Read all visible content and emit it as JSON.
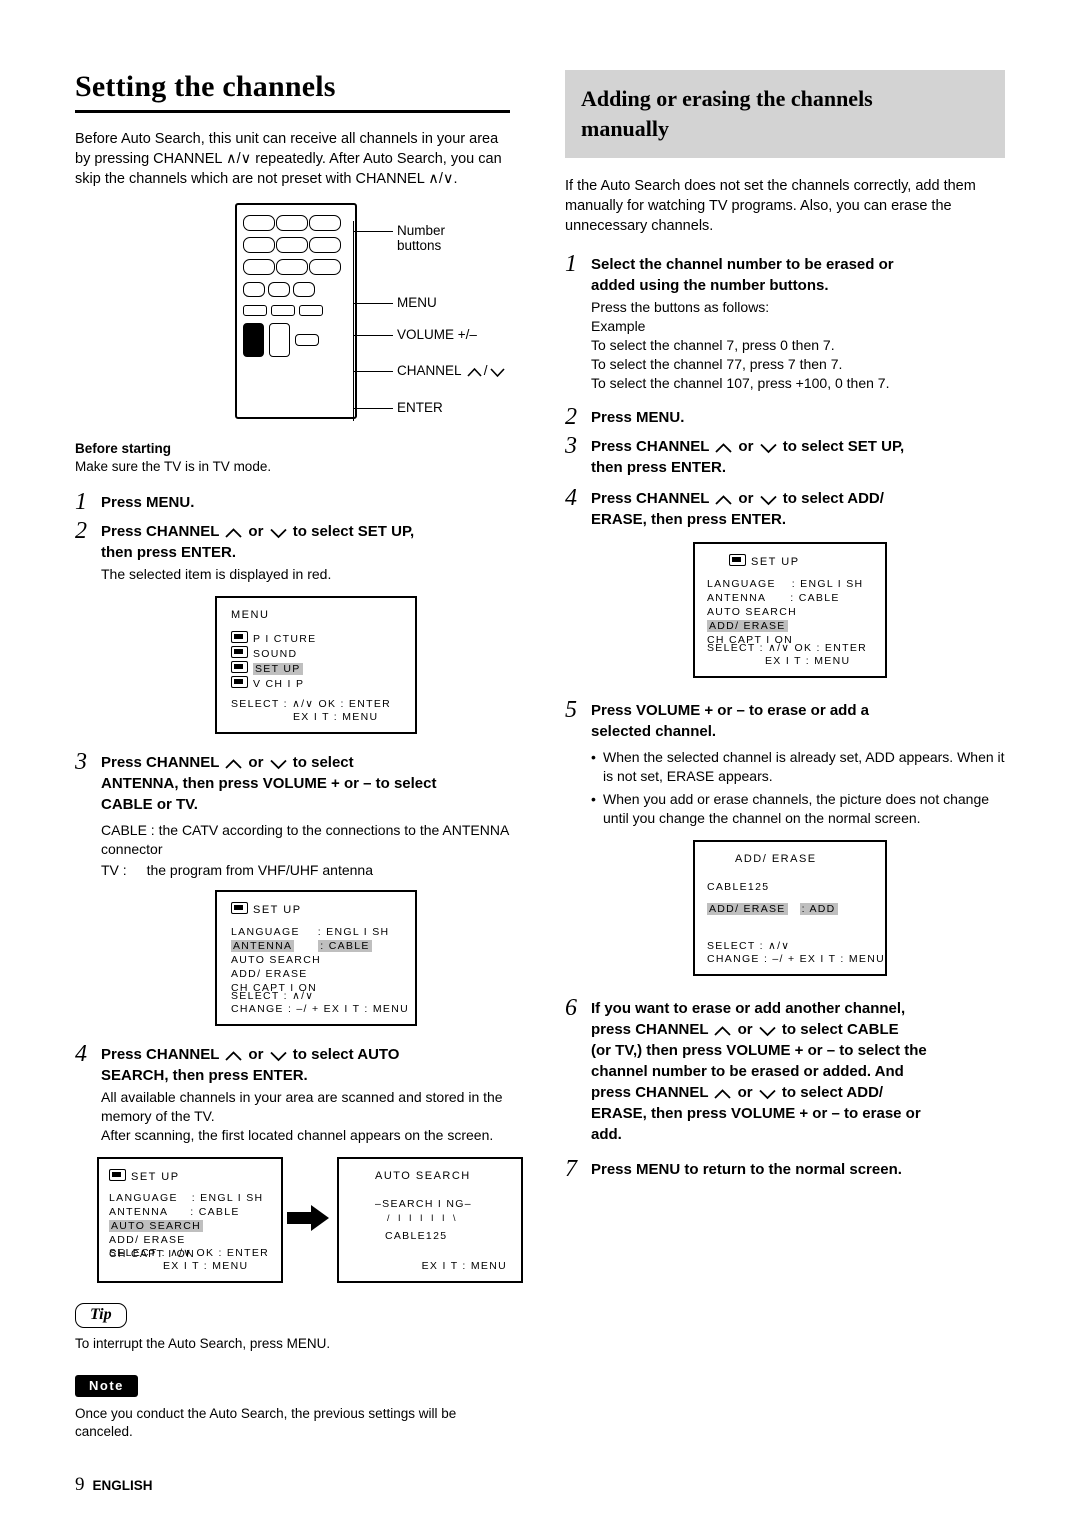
{
  "left": {
    "title": "Setting the channels",
    "intro": "Before Auto Search, this unit can receive all channels in your area by pressing CHANNEL ∧/∨ repeatedly. After Auto Search, you can skip the channels which are not preset with CHANNEL ∧/∨.",
    "remote_labels": {
      "number_buttons": "Number\nbuttons",
      "menu": "MENU",
      "volume": "VOLUME +/–",
      "channel": "CHANNEL ∧/∨",
      "enter": "ENTER"
    },
    "before_starting_heading": "Before starting",
    "before_starting_text": "Make sure the TV is in TV mode.",
    "steps": [
      {
        "num": "1",
        "heading": "Press MENU.",
        "detail": ""
      },
      {
        "num": "2",
        "heading": "Press CHANNEL ∧ or ∨ to select SET UP, then press ENTER.",
        "detail": "The selected item is displayed in red."
      },
      {
        "num": "3",
        "heading": "Press CHANNEL ∧ or ∨ to select ANTENNA, then press VOLUME + or – to select CABLE or TV.",
        "detail": ""
      },
      {
        "num": "4",
        "heading": "Press CHANNEL ∧ or ∨ to select AUTO SEARCH, then press ENTER.",
        "detail": "All available channels in your area are scanned and stored in the memory of the TV.\nAfter scanning, the first located channel appears on the screen."
      }
    ],
    "cable_desc_1_label": "CABLE :",
    "cable_desc_1_text": "the CATV according to the connections to the ANTENNA connector",
    "cable_desc_2_label": "TV :",
    "cable_desc_2_text": "the program from VHF/UHF antenna",
    "osd_menu": {
      "title": "MENU",
      "items": [
        "P I CTURE",
        "SOUND",
        "SET UP",
        "V CH I P"
      ],
      "highlight_index": 2,
      "footer_line1": "SELECT :  ∧/∨     OK : ENTER",
      "footer_line2": "EX I T : MENU"
    },
    "osd_setup_antenna": {
      "title": "SET UP",
      "rows": [
        {
          "label": "LANGUAGE",
          "value": ": ENGL I SH",
          "highlight": false
        },
        {
          "label": "ANTENNA",
          "value": ": CABLE",
          "highlight": true
        },
        {
          "label": "AUTO  SEARCH",
          "value": "",
          "highlight": false
        },
        {
          "label": "ADD/ ERASE",
          "value": "",
          "highlight": false
        },
        {
          "label": "CH  CAPT I ON",
          "value": "",
          "highlight": false
        }
      ],
      "footer_line1": "SELECT :  ∧/∨",
      "footer_line2": "CHANGE :  –/ +    EX I T : MENU"
    },
    "osd_setup_autosearch": {
      "title": "SET UP",
      "rows": [
        {
          "label": "LANGUAGE",
          "value": ": ENGL I SH",
          "highlight": false
        },
        {
          "label": "ANTENNA",
          "value": ": CABLE",
          "highlight": false
        },
        {
          "label": "AUTO  SEARCH",
          "value": "",
          "highlight": true
        },
        {
          "label": "ADD/ ERASE",
          "value": "",
          "highlight": false
        },
        {
          "label": "CH  CAPT I ON",
          "value": "",
          "highlight": false
        }
      ],
      "footer_line1": "SELECT :  ∧/∨     OK : ENTER",
      "footer_line2": "EX I T : MENU"
    },
    "osd_search": {
      "title": "AUTO SEARCH",
      "searching": "–SEARCH I NG–",
      "channel": "CABLE125",
      "footer": "EX I T : MENU"
    },
    "tip_label": "Tip",
    "tip_text": "To interrupt the Auto Search, press MENU.",
    "note_label": "Note",
    "note_text": "Once you conduct the Auto Search, the previous settings will be canceled."
  },
  "right": {
    "title": "Adding or erasing the channels manually",
    "intro": "If the Auto Search does not set the channels correctly, add them manually for watching TV programs. Also, you can erase the unnecessary channels.",
    "steps": [
      {
        "num": "1",
        "heading": "Select the channel number to be erased or added using the number buttons.",
        "detail": "Press the buttons as follows:\nExample\nTo select the channel 7, press 0 then 7.\nTo select the channel 77, press 7 then 7.\nTo select the channel 107, press +100, 0 then 7."
      },
      {
        "num": "2",
        "heading": "Press MENU.",
        "detail": ""
      },
      {
        "num": "3",
        "heading": "Press CHANNEL ∧ or ∨ to select SET UP, then press ENTER.",
        "detail": ""
      },
      {
        "num": "4",
        "heading": "Press CHANNEL ∧ or ∨ to select ADD/ERASE, then press ENTER.",
        "detail": ""
      },
      {
        "num": "5",
        "heading": "Press VOLUME + or – to erase or add a selected channel.",
        "detail": ""
      },
      {
        "num": "6",
        "heading": "If you want to erase or add another channel, press CHANNEL ∧ or ∨ to select CABLE (or TV,) then press VOLUME + or – to select the channel number to be erased or added. And press CHANNEL ∧ or ∨ to select ADD/ERASE, then press VOLUME + or – to erase or add.",
        "detail": ""
      },
      {
        "num": "7",
        "heading": "Press MENU to return to the normal screen.",
        "detail": ""
      }
    ],
    "bullets": [
      "When the selected channel is already set, ADD appears. When it is not set, ERASE appears.",
      "When you add or erase channels, the picture does not change until you change the channel on the normal screen."
    ],
    "osd_setup_adderase": {
      "title": "SET UP",
      "rows": [
        {
          "label": "LANGUAGE",
          "value": ": ENGL I SH",
          "highlight": false
        },
        {
          "label": "ANTENNA",
          "value": ": CABLE",
          "highlight": false
        },
        {
          "label": "AUTO  SEARCH",
          "value": "",
          "highlight": false
        },
        {
          "label": "ADD/ ERASE",
          "value": "",
          "highlight": true
        },
        {
          "label": "CH  CAPT I ON",
          "value": "",
          "highlight": false
        }
      ],
      "footer_line1": "SELECT :  ∧/∨     OK : ENTER",
      "footer_line2": "EX I T : MENU"
    },
    "osd_adderase": {
      "title": "ADD/ ERASE",
      "channel": "CABLE125",
      "field_label": "ADD/ ERASE",
      "field_value": ": ADD",
      "footer_line1": "SELECT :  ∧/∨",
      "footer_line2": "CHANGE :  –/ +   EX I T : MENU"
    }
  },
  "footer": {
    "page": "9",
    "language": "ENGLISH"
  },
  "colors": {
    "highlight": "#bfbfbf",
    "heading_band": "#d3d3d3",
    "text": "#000000"
  }
}
